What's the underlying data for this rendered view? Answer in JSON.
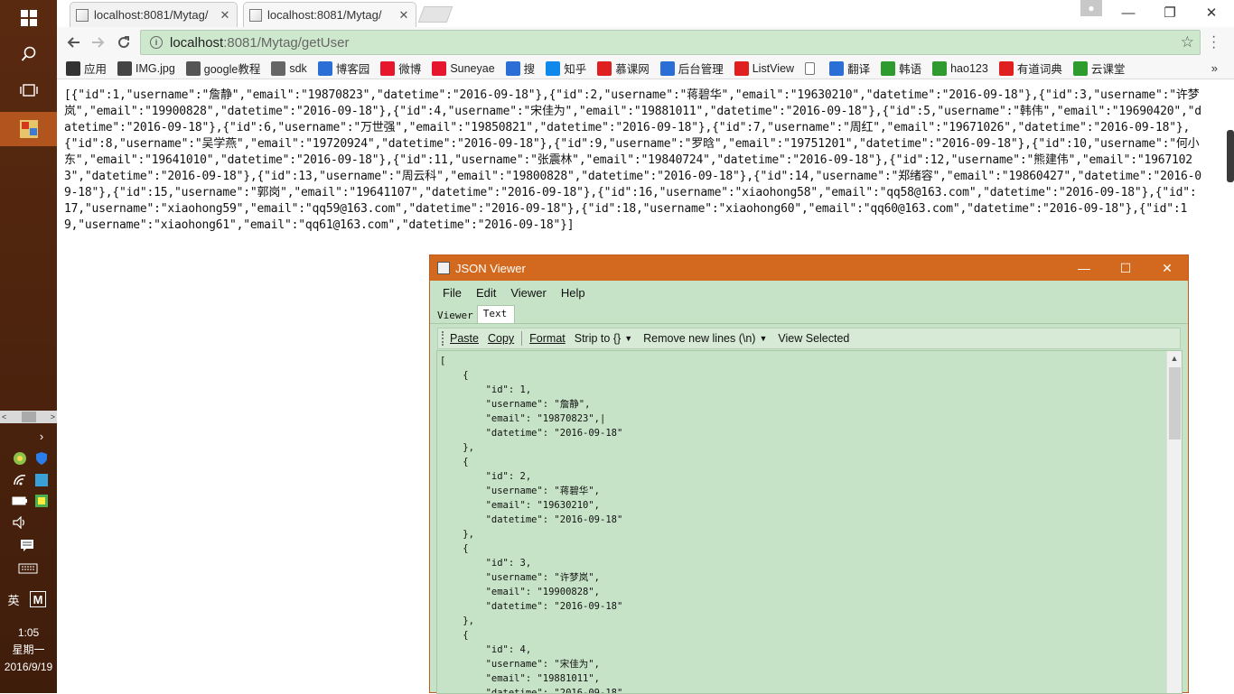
{
  "taskbar": {
    "clock_time": "1:05",
    "clock_day": "星期一",
    "clock_date": "2016/9/19",
    "ime_label": "英",
    "ime_mode": "M"
  },
  "browser": {
    "tabs": [
      {
        "title": "localhost:8081/Mytag/"
      },
      {
        "title": "localhost:8081/Mytag/"
      }
    ],
    "url_host": "localhost",
    "url_rest": ":8081/Mytag/getUser",
    "bookmarks": [
      {
        "label": "应用",
        "icon": "apps-icon",
        "color": "#333333"
      },
      {
        "label": "IMG.jpg",
        "icon": "image-icon",
        "color": "#444444"
      },
      {
        "label": "google教程",
        "icon": "book-icon",
        "color": "#555555"
      },
      {
        "label": "sdk",
        "icon": "loading-icon",
        "color": "#666666"
      },
      {
        "label": "博客园",
        "icon": "globe-icon",
        "color": "#2b6fd6"
      },
      {
        "label": "微博",
        "icon": "weibo-icon",
        "color": "#e6162d"
      },
      {
        "label": "Suneyae",
        "icon": "weibo-icon",
        "color": "#e6162d"
      },
      {
        "label": "搜",
        "icon": "globe-icon",
        "color": "#2b6fd6"
      },
      {
        "label": "知乎",
        "icon": "zhihu-icon",
        "color": "#0f88eb"
      },
      {
        "label": "慕课网",
        "icon": "flame-icon",
        "color": "#e02020"
      },
      {
        "label": "后台管理",
        "icon": "globe-icon",
        "color": "#2b6fd6"
      },
      {
        "label": "ListView",
        "icon": "flame-icon",
        "color": "#e02020"
      },
      {
        "label": "",
        "icon": "page-icon",
        "color": "#ffffff"
      },
      {
        "label": "翻译",
        "icon": "translate-icon",
        "color": "#2b6fd6"
      },
      {
        "label": "韩语",
        "icon": "korean-icon",
        "color": "#2e9b2e"
      },
      {
        "label": "hao123",
        "icon": "hao-icon",
        "color": "#2e9b2e"
      },
      {
        "label": "有道词典",
        "icon": "youdao-icon",
        "color": "#e02020"
      },
      {
        "label": "云课堂",
        "icon": "cloud-icon",
        "color": "#2e9b2e"
      }
    ],
    "more_label": "»"
  },
  "raw_json": "[{\"id\":1,\"username\":\"詹静\",\"email\":\"19870823\",\"datetime\":\"2016-09-18\"},{\"id\":2,\"username\":\"蒋碧华\",\"email\":\"19630210\",\"datetime\":\"2016-09-18\"},{\"id\":3,\"username\":\"许梦岚\",\"email\":\"19900828\",\"datetime\":\"2016-09-18\"},{\"id\":4,\"username\":\"宋佳为\",\"email\":\"19881011\",\"datetime\":\"2016-09-18\"},{\"id\":5,\"username\":\"韩伟\",\"email\":\"19690420\",\"datetime\":\"2016-09-18\"},{\"id\":6,\"username\":\"万世强\",\"email\":\"19850821\",\"datetime\":\"2016-09-18\"},{\"id\":7,\"username\":\"周红\",\"email\":\"19671026\",\"datetime\":\"2016-09-18\"},{\"id\":8,\"username\":\"吴学燕\",\"email\":\"19720924\",\"datetime\":\"2016-09-18\"},{\"id\":9,\"username\":\"罗晗\",\"email\":\"19751201\",\"datetime\":\"2016-09-18\"},{\"id\":10,\"username\":\"何小东\",\"email\":\"19641010\",\"datetime\":\"2016-09-18\"},{\"id\":11,\"username\":\"张震林\",\"email\":\"19840724\",\"datetime\":\"2016-09-18\"},{\"id\":12,\"username\":\"熊建伟\",\"email\":\"19671023\",\"datetime\":\"2016-09-18\"},{\"id\":13,\"username\":\"周云科\",\"email\":\"19800828\",\"datetime\":\"2016-09-18\"},{\"id\":14,\"username\":\"郑绪容\",\"email\":\"19860427\",\"datetime\":\"2016-09-18\"},{\"id\":15,\"username\":\"郭岗\",\"email\":\"19641107\",\"datetime\":\"2016-09-18\"},{\"id\":16,\"username\":\"xiaohong58\",\"email\":\"qq58@163.com\",\"datetime\":\"2016-09-18\"},{\"id\":17,\"username\":\"xiaohong59\",\"email\":\"qq59@163.com\",\"datetime\":\"2016-09-18\"},{\"id\":18,\"username\":\"xiaohong60\",\"email\":\"qq60@163.com\",\"datetime\":\"2016-09-18\"},{\"id\":19,\"username\":\"xiaohong61\",\"email\":\"qq61@163.com\",\"datetime\":\"2016-09-18\"}]",
  "viewer": {
    "title": "JSON Viewer",
    "menu": [
      "File",
      "Edit",
      "Viewer",
      "Help"
    ],
    "tabs": [
      "Viewer",
      "Text"
    ],
    "toolbar": {
      "paste": "Paste",
      "copy": "Copy",
      "format": "Format",
      "strip": "Strip to {}",
      "remove_newlines": "Remove new lines (\\n)",
      "view_selected": "View Selected"
    },
    "formatted_text": "[\n    {\n        \"id\": 1,\n        \"username\": \"詹静\",\n        \"email\": \"19870823\",|\n        \"datetime\": \"2016-09-18\"\n    },\n    {\n        \"id\": 2,\n        \"username\": \"蒋碧华\",\n        \"email\": \"19630210\",\n        \"datetime\": \"2016-09-18\"\n    },\n    {\n        \"id\": 3,\n        \"username\": \"许梦岚\",\n        \"email\": \"19900828\",\n        \"datetime\": \"2016-09-18\"\n    },\n    {\n        \"id\": 4,\n        \"username\": \"宋佳为\",\n        \"email\": \"19881011\",\n        \"datetime\": \"2016-09-18\""
  }
}
